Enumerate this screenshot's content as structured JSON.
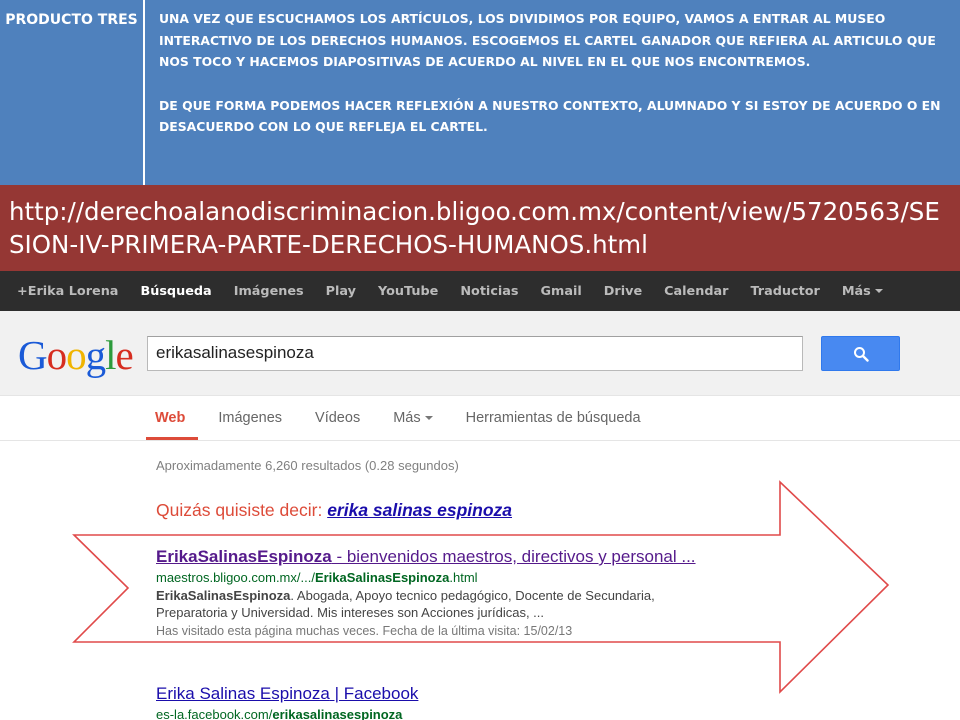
{
  "slide": {
    "left_cell": "PRODUCTO TRES",
    "paragraph_1": "UNA VEZ QUE ESCUCHAMOS LOS ARTÍCULOS, LOS DIVIDIMOS POR EQUIPO, VAMOS A ENTRAR AL MUSEO INTERACTIVO DE LOS DERECHOS HUMANOS.  ESCOGEMOS EL CARTEL GANADOR QUE REFIERA AL ARTICULO QUE NOS TOCO Y HACEMOS DIAPOSITIVAS DE ACUERDO AL NIVEL EN EL QUE NOS ENCONTREMOS.",
    "paragraph_2": "DE QUE FORMA PODEMOS HACER REFLEXIÓN A NUESTRO CONTEXTO, ALUMNADO Y SI ESTOY DE ACUERDO O EN DESACUERDO CON LO QUE REFLEJA EL CARTEL.",
    "url_banner": "http://derechoalanodiscriminacion.bligoo.com.mx/content/view/5720563/SESION-IV-PRIMERA-PARTE-DERECHOS-HUMANOS.html"
  },
  "gbar": {
    "items": [
      "+Erika Lorena",
      "Búsqueda",
      "Imágenes",
      "Play",
      "YouTube",
      "Noticias",
      "Gmail",
      "Drive",
      "Calendar",
      "Traductor",
      "Más"
    ]
  },
  "logo": [
    "G",
    "o",
    "o",
    "g",
    "l",
    "e"
  ],
  "search": {
    "value": "erikasalinasespinoza"
  },
  "tabs": [
    "Web",
    "Imágenes",
    "Vídeos",
    "Más",
    "Herramientas de búsqueda"
  ],
  "results": {
    "stats": "Aproximadamente 6,260 resultados (0.28 segundos)",
    "did_you_mean_label": "Quizás quisiste decir: ",
    "did_you_mean_link": "erika salinas espinoza",
    "items": [
      {
        "title_bold": "ErikaSalinasEspinoza",
        "title_rest": " - bienvenidos maestros, directivos y personal ...",
        "url_prefix": "maestros.bligoo.com.mx/.../",
        "url_bold": "ErikaSalinasEspinoza",
        "url_suffix": ".html",
        "snippet_bold": "ErikaSalinasEspinoza",
        "snippet": ". Abogada, Apoyo tecnico pedagógico, Docente de Secundaria, Preparatoria y Universidad. Mis intereses son Acciones jurídicas, ...",
        "visited": "Has visitado esta página muchas veces. Fecha de la última visita: 15/02/13"
      },
      {
        "title_bold": "Erika Salinas Espinoza",
        "title_rest": " | Facebook",
        "url_prefix": "es-la.facebook.com/",
        "url_bold": "erikasalinasespinoza",
        "url_suffix": ""
      }
    ]
  },
  "colors": {
    "table_blue": "#4f81bd",
    "banner_red": "#953734",
    "gbar_dark": "#2d2d2d",
    "google_red": "#dd4b39",
    "link_purple": "#551a8b",
    "url_green": "#006621",
    "button_blue": "#4889f1"
  },
  "icons": {
    "search_button": "search-icon",
    "arrow": "right-arrow-outline"
  }
}
